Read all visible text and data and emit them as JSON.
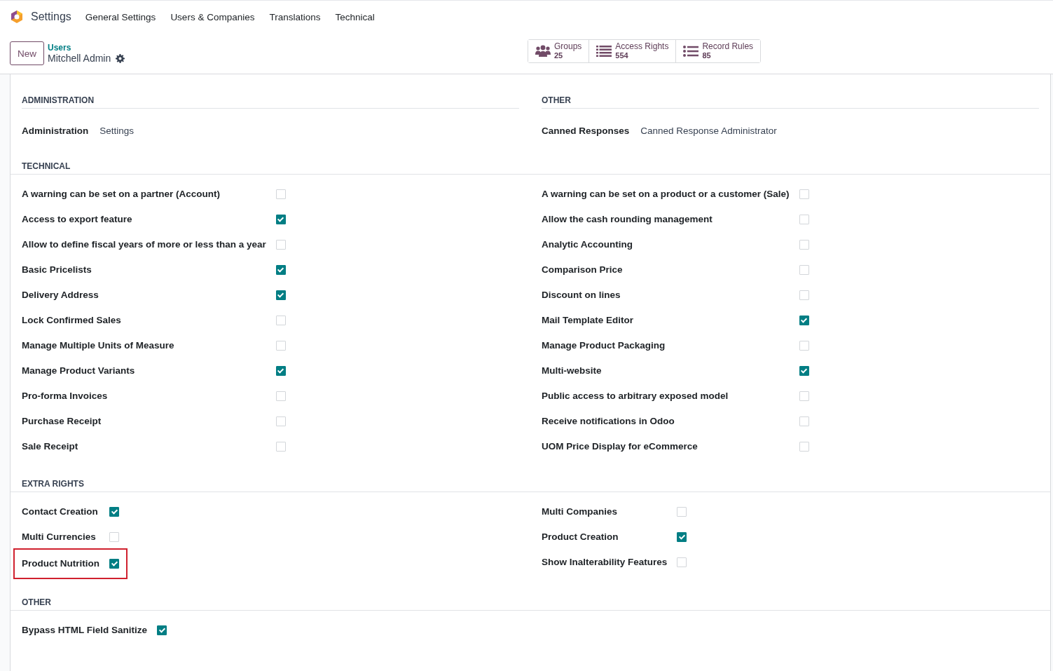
{
  "app": {
    "name": "Settings"
  },
  "menu": [
    "General Settings",
    "Users & Companies",
    "Translations",
    "Technical"
  ],
  "new_button": "New",
  "breadcrumb": {
    "parent": "Users",
    "current": "Mitchell Admin"
  },
  "stat_buttons": [
    {
      "kind": "groups",
      "label": "Groups",
      "count": "25"
    },
    {
      "kind": "access",
      "label": "Access Rights",
      "count": "554"
    },
    {
      "kind": "rules",
      "label": "Record Rules",
      "count": "85"
    }
  ],
  "top_sections": [
    {
      "title": "ADMINISTRATION",
      "fields": [
        {
          "label": "Administration",
          "value": "Settings"
        }
      ]
    },
    {
      "title": "OTHER",
      "fields": [
        {
          "label": "Canned Responses",
          "value": "Canned Response Administrator"
        }
      ]
    }
  ],
  "sections": [
    {
      "title": "TECHNICAL",
      "left": [
        {
          "label": "A warning can be set on a partner (Account)",
          "checked": false
        },
        {
          "label": "Access to export feature",
          "checked": true
        },
        {
          "label": "Allow to define fiscal years of more or less than a year",
          "checked": false
        },
        {
          "label": "Basic Pricelists",
          "checked": true
        },
        {
          "label": "Delivery Address",
          "checked": true
        },
        {
          "label": "Lock Confirmed Sales",
          "checked": false
        },
        {
          "label": "Manage Multiple Units of Measure",
          "checked": false
        },
        {
          "label": "Manage Product Variants",
          "checked": true
        },
        {
          "label": "Pro-forma Invoices",
          "checked": false
        },
        {
          "label": "Purchase Receipt",
          "checked": false
        },
        {
          "label": "Sale Receipt",
          "checked": false
        }
      ],
      "right": [
        {
          "label": "A warning can be set on a product or a customer (Sale)",
          "checked": false
        },
        {
          "label": "Allow the cash rounding management",
          "checked": false
        },
        {
          "label": "Analytic Accounting",
          "checked": false
        },
        {
          "label": "Comparison Price",
          "checked": false
        },
        {
          "label": "Discount on lines",
          "checked": false
        },
        {
          "label": "Mail Template Editor",
          "checked": true
        },
        {
          "label": "Manage Product Packaging",
          "checked": false
        },
        {
          "label": "Multi-website",
          "checked": true
        },
        {
          "label": "Public access to arbitrary exposed model",
          "checked": false
        },
        {
          "label": "Receive notifications in Odoo",
          "checked": false
        },
        {
          "label": "UOM Price Display for eCommerce",
          "checked": false
        }
      ]
    },
    {
      "title": "EXTRA RIGHTS",
      "left": [
        {
          "label": "Contact Creation",
          "checked": true,
          "highlighted": false
        },
        {
          "label": "Multi Currencies",
          "checked": false,
          "highlighted": false
        },
        {
          "label": "Product Nutrition",
          "checked": true,
          "highlighted": true
        }
      ],
      "right": [
        {
          "label": "Multi Companies",
          "checked": false,
          "highlighted": false
        },
        {
          "label": "Product Creation",
          "checked": true,
          "highlighted": false
        },
        {
          "label": "Show Inalterability Features",
          "checked": false,
          "highlighted": false
        }
      ]
    },
    {
      "title": "OTHER",
      "left": [
        {
          "label": "Bypass HTML Field Sanitize",
          "checked": true
        }
      ]
    }
  ]
}
